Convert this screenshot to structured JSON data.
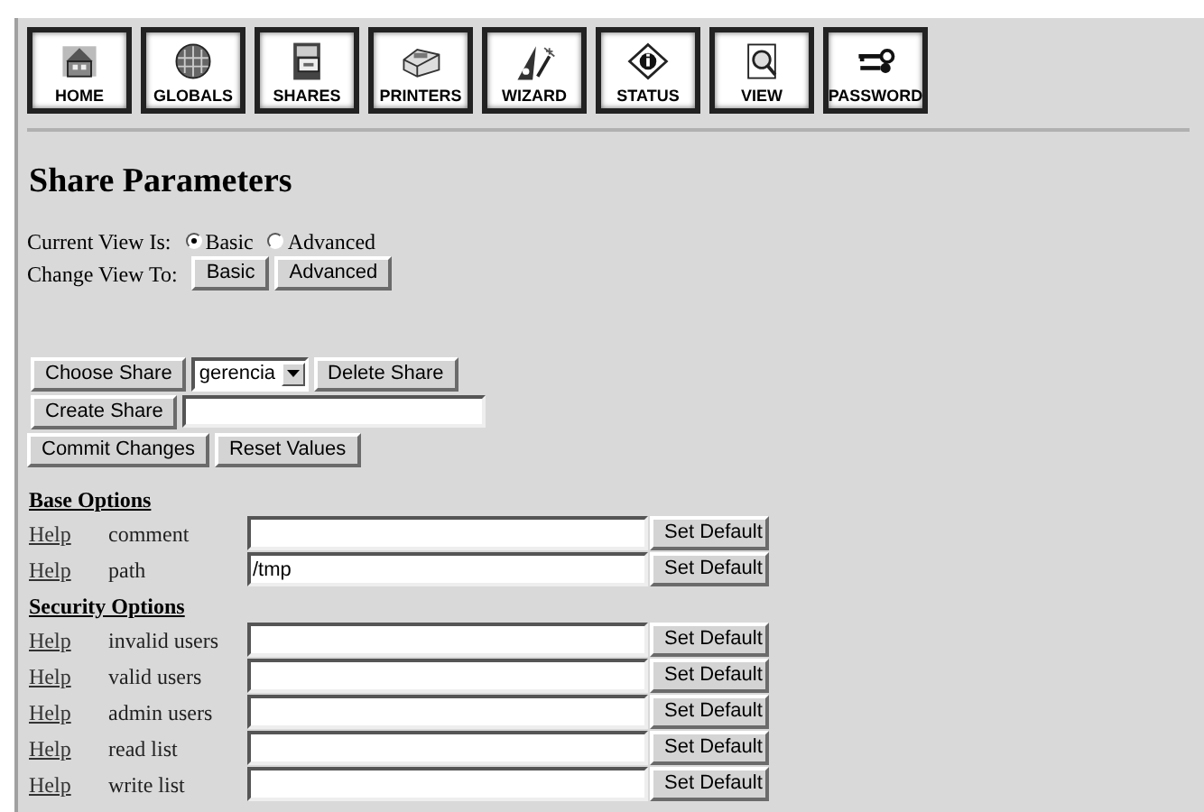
{
  "toolbar": [
    {
      "label": "HOME",
      "kind": "home"
    },
    {
      "label": "GLOBALS",
      "kind": "globe"
    },
    {
      "label": "SHARES",
      "kind": "cabinet"
    },
    {
      "label": "PRINTERS",
      "kind": "printer"
    },
    {
      "label": "WIZARD",
      "kind": "wizard"
    },
    {
      "label": "STATUS",
      "kind": "info"
    },
    {
      "label": "VIEW",
      "kind": "view"
    },
    {
      "label": "PASSWORD",
      "kind": "keys"
    }
  ],
  "title": "Share Parameters",
  "current_view": {
    "label": "Current View Is:",
    "options": [
      {
        "label": "Basic",
        "selected": true
      },
      {
        "label": "Advanced",
        "selected": false
      }
    ]
  },
  "change_view": {
    "label": "Change View To:",
    "buttons": [
      "Basic",
      "Advanced"
    ]
  },
  "share_controls": {
    "choose_button": "Choose Share",
    "share_select": "gerencia",
    "delete_button": "Delete Share",
    "create_button": "Create Share",
    "commit_button": "Commit Changes",
    "reset_button": "Reset Values"
  },
  "sections": [
    {
      "title": "Base Options",
      "params": [
        {
          "help": "Help",
          "name": "comment",
          "button": "Set Default"
        },
        {
          "help": "Help",
          "name": "path",
          "value": "/tmp",
          "button": "Set Default"
        }
      ]
    },
    {
      "title": "Security Options",
      "params": [
        {
          "help": "Help",
          "name": "invalid users",
          "button": "Set Default"
        },
        {
          "help": "Help",
          "name": "valid users",
          "button": "Set Default"
        },
        {
          "help": "Help",
          "name": "admin users",
          "button": "Set Default"
        },
        {
          "help": "Help",
          "name": "read list",
          "button": "Set Default"
        },
        {
          "help": "Help",
          "name": "write list",
          "button": "Set Default"
        }
      ]
    }
  ]
}
